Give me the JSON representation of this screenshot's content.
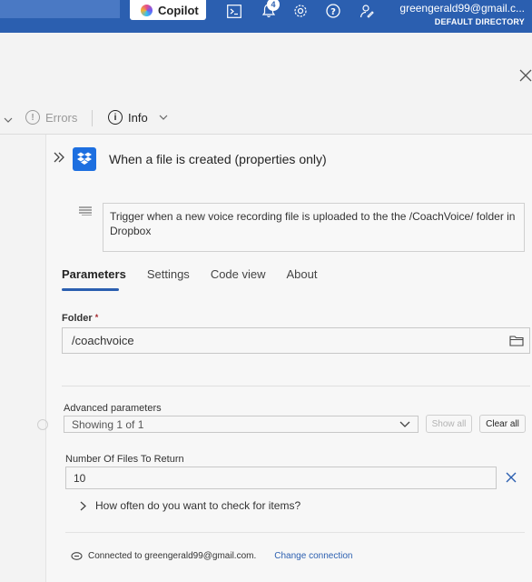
{
  "topbar": {
    "copilot_label": "Copilot",
    "notification_count": "4",
    "account_email": "greengerald99@gmail.c...",
    "directory": "DEFAULT DIRECTORY",
    "icons": [
      "terminal-icon",
      "bell-icon",
      "gear-icon",
      "help-icon",
      "feedback-icon"
    ]
  },
  "status": {
    "errors_label": "Errors",
    "info_label": "Info"
  },
  "trigger": {
    "title": "When a file is created (properties only)",
    "description": "Trigger when a new voice recording file is uploaded  to the the /CoachVoice/ folder in Dropbox"
  },
  "tabs": [
    "Parameters",
    "Settings",
    "Code view",
    "About"
  ],
  "folder": {
    "label": "Folder",
    "required_mark": "*",
    "value": "/coachvoice"
  },
  "advanced": {
    "label": "Advanced parameters",
    "showing": "Showing 1 of 1",
    "show_all": "Show all",
    "clear_all": "Clear all"
  },
  "num_files": {
    "label": "Number Of Files To Return",
    "value": "10"
  },
  "how_often": "How often do you want to check for items?",
  "connection": {
    "text": "Connected to greengerald99@gmail.com.",
    "change": "Change connection"
  },
  "colors": {
    "accent": "#2b5fb0",
    "dropbox": "#1d6fe0"
  }
}
